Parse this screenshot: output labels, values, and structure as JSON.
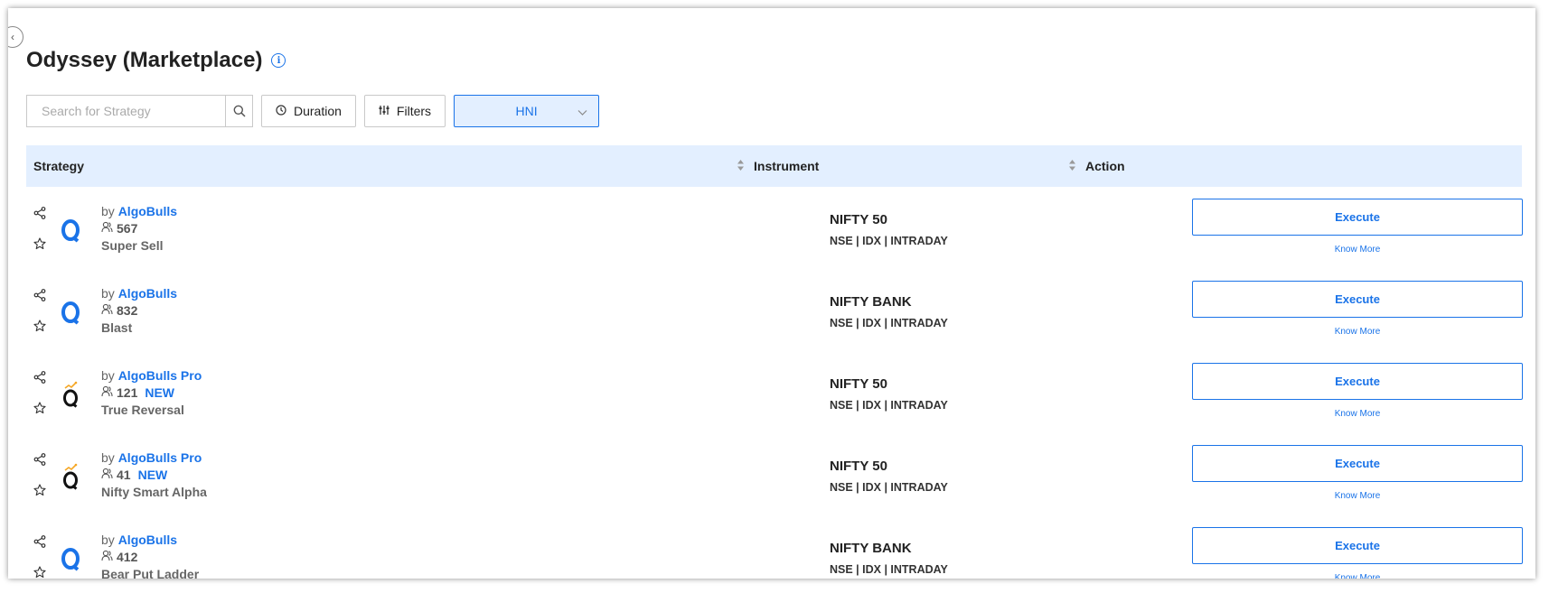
{
  "page": {
    "title": "Odyssey (Marketplace)",
    "info_icon": "info-icon",
    "collapse_icon": "chevron-left-icon"
  },
  "toolbar": {
    "search_placeholder": "Search for Strategy",
    "search_value": "",
    "duration_label": "Duration",
    "filters_label": "Filters",
    "segment_selected": "HNI"
  },
  "table": {
    "headers": {
      "strategy": "Strategy",
      "instrument": "Instrument",
      "action": "Action"
    },
    "rows": [
      {
        "by": "by",
        "author": "AlgoBulls",
        "subscribers": "567",
        "badge": "",
        "name": "Super Sell",
        "logo": "algobulls",
        "instrument": "NIFTY 50",
        "instrument_meta": "NSE | IDX | INTRADAY",
        "execute_label": "Execute",
        "know_more_label": "Know More"
      },
      {
        "by": "by",
        "author": "AlgoBulls",
        "subscribers": "832",
        "badge": "",
        "name": "Blast",
        "logo": "algobulls",
        "instrument": "NIFTY BANK",
        "instrument_meta": "NSE | IDX | INTRADAY",
        "execute_label": "Execute",
        "know_more_label": "Know More"
      },
      {
        "by": "by",
        "author": "AlgoBulls Pro",
        "subscribers": "121",
        "badge": "NEW",
        "name": "True Reversal",
        "logo": "algobulls-pro",
        "instrument": "NIFTY 50",
        "instrument_meta": "NSE | IDX | INTRADAY",
        "execute_label": "Execute",
        "know_more_label": "Know More"
      },
      {
        "by": "by",
        "author": "AlgoBulls Pro",
        "subscribers": "41",
        "badge": "NEW",
        "name": "Nifty Smart Alpha",
        "logo": "algobulls-pro",
        "instrument": "NIFTY 50",
        "instrument_meta": "NSE | IDX | INTRADAY",
        "execute_label": "Execute",
        "know_more_label": "Know More"
      },
      {
        "by": "by",
        "author": "AlgoBulls",
        "subscribers": "412",
        "badge": "",
        "name": "Bear Put Ladder",
        "logo": "algobulls",
        "instrument": "NIFTY BANK",
        "instrument_meta": "NSE | IDX | INTRADAY",
        "execute_label": "Execute",
        "know_more_label": "Know More"
      }
    ]
  },
  "colors": {
    "accent": "#1a73e8",
    "header_bg": "#e3efff",
    "pro_logo_accent": "#f5a623"
  }
}
